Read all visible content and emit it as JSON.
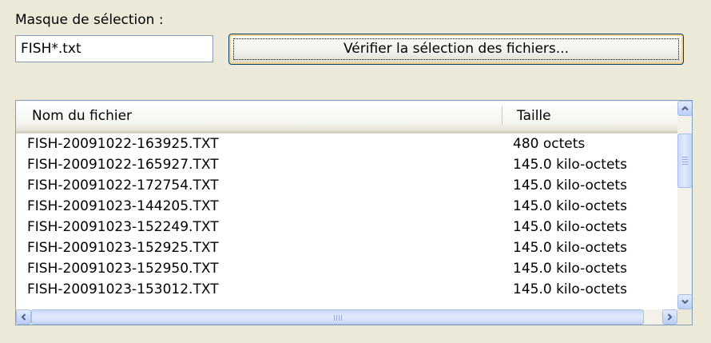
{
  "mask": {
    "label": "Masque de sélection :",
    "value": "FISH*.txt"
  },
  "verify_button": {
    "label": "Vérifier la sélection des fichiers..."
  },
  "file_list": {
    "columns": [
      "Nom du fichier",
      "Taille"
    ],
    "rows": [
      {
        "name": "FISH-20091022-163925.TXT",
        "size": "480 octets"
      },
      {
        "name": "FISH-20091022-165927.TXT",
        "size": "145.0 kilo-octets"
      },
      {
        "name": "FISH-20091022-172754.TXT",
        "size": "145.0 kilo-octets"
      },
      {
        "name": "FISH-20091023-144205.TXT",
        "size": "145.0 kilo-octets"
      },
      {
        "name": "FISH-20091023-152249.TXT",
        "size": "145.0 kilo-octets"
      },
      {
        "name": "FISH-20091023-152925.TXT",
        "size": "145.0 kilo-octets"
      },
      {
        "name": "FISH-20091023-152950.TXT",
        "size": "145.0 kilo-octets"
      },
      {
        "name": "FISH-20091023-153012.TXT",
        "size": "145.0 kilo-octets"
      }
    ]
  },
  "icons": {
    "scroll_up": "chevron-up-icon",
    "scroll_down": "chevron-down-icon",
    "scroll_left": "chevron-left-icon",
    "scroll_right": "chevron-right-icon"
  },
  "colors": {
    "window_bg": "#ece9d8",
    "border": "#7f9db9",
    "scroll_blue": "#4d6185"
  }
}
